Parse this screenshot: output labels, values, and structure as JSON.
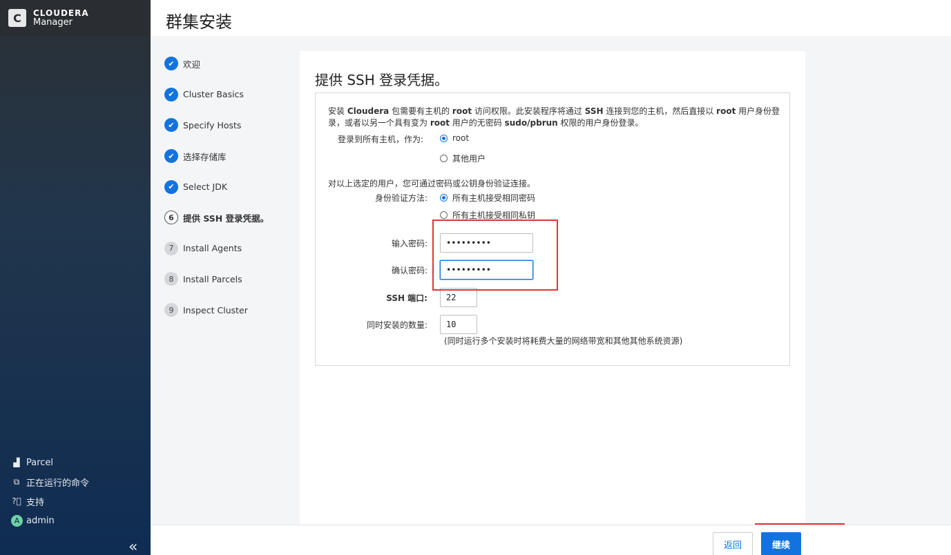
{
  "brand": {
    "line1": "CLOUDERA",
    "line2": "Manager",
    "logo_letter": "C"
  },
  "sidebar": {
    "items": [
      {
        "icon": "parcel-icon",
        "label": "Parcel"
      },
      {
        "icon": "running-commands-icon",
        "label": "正在运行的命令"
      },
      {
        "icon": "help-icon",
        "label": "支持"
      },
      {
        "icon": "avatar",
        "label": "admin",
        "avatar_letter": "A"
      }
    ],
    "collapse_glyph": "«"
  },
  "header": {
    "title": "群集安装"
  },
  "steps": [
    {
      "num": "",
      "label": "欢迎",
      "state": "done"
    },
    {
      "num": "",
      "label": "Cluster Basics",
      "state": "done"
    },
    {
      "num": "",
      "label": "Specify Hosts",
      "state": "done"
    },
    {
      "num": "",
      "label": "选择存储库",
      "state": "done"
    },
    {
      "num": "",
      "label": "Select JDK",
      "state": "done"
    },
    {
      "num": "6",
      "label": "提供 SSH 登录凭据。",
      "state": "current"
    },
    {
      "num": "7",
      "label": "Install Agents",
      "state": "todo"
    },
    {
      "num": "8",
      "label": "Install Parcels",
      "state": "todo"
    },
    {
      "num": "9",
      "label": "Inspect Cluster",
      "state": "todo"
    }
  ],
  "main": {
    "title": "提供 SSH 登录凭据。",
    "intro_parts": [
      "安装 ",
      "Cloudera",
      " 包需要有主机的 ",
      "root",
      " 访问权限。此安装程序将通过 ",
      "SSH",
      " 连接到您的主机，然后直接以 ",
      "root",
      " 用户身份登录，或者以另一个具有变为 ",
      "root",
      " 用户的无密码 ",
      "sudo/pbrun",
      " 权限的用户身份登录。"
    ],
    "login_label": "登录到所有主机，作为:",
    "login_options": [
      {
        "label": "root",
        "selected": true
      },
      {
        "label": "其他用户",
        "selected": false
      }
    ],
    "auth_intro": "对以上选定的用户，您可通过密码或公钥身份验证连接。",
    "auth_label": "身份验证方法:",
    "auth_options": [
      {
        "label": "所有主机接受相同密码",
        "selected": true
      },
      {
        "label": "所有主机接受相同私钥",
        "selected": false
      }
    ],
    "password_label": "输入密码:",
    "password_value": "•••••••••",
    "confirm_label": "确认密码:",
    "confirm_value": "•••••••••",
    "ssh_port_label": "SSH 端口:",
    "ssh_port_value": "22",
    "concurrent_label": "同时安装的数量:",
    "concurrent_value": "10",
    "concurrent_note": "(同时运行多个安装时将耗费大量的网络带宽和其他其他系统资源)"
  },
  "footer": {
    "back_label": "返回",
    "continue_label": "继续"
  },
  "colors": {
    "accent": "#1273de",
    "highlight": "#e03535"
  }
}
